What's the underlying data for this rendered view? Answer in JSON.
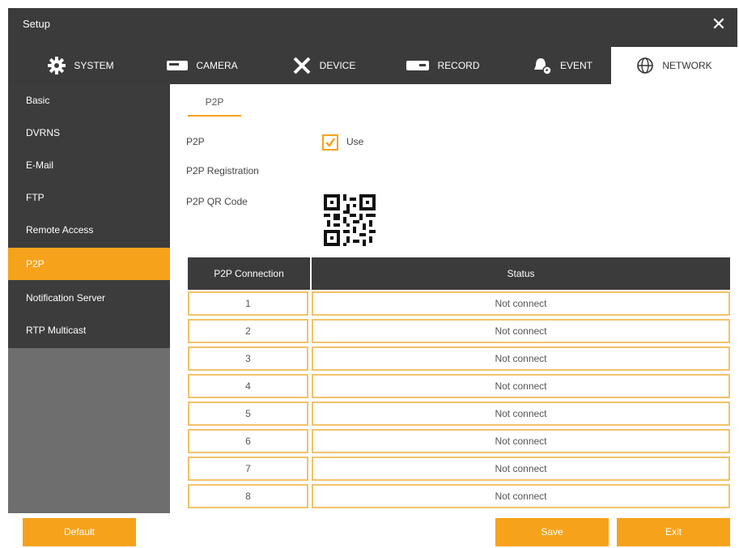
{
  "window": {
    "title": "Setup"
  },
  "tabs": [
    {
      "label": "SYSTEM",
      "icon": "gear-icon"
    },
    {
      "label": "CAMERA",
      "icon": "camera-icon"
    },
    {
      "label": "DEVICE",
      "icon": "tools-icon"
    },
    {
      "label": "RECORD",
      "icon": "recorder-icon"
    },
    {
      "label": "EVENT",
      "icon": "bell-icon"
    },
    {
      "label": "NETWORK",
      "icon": "globe-icon",
      "active": true
    }
  ],
  "sidebar": {
    "items": [
      {
        "label": "Basic"
      },
      {
        "label": "DVRNS"
      },
      {
        "label": "E-Mail"
      },
      {
        "label": "FTP"
      },
      {
        "label": "Remote Access"
      },
      {
        "label": "P2P",
        "active": true
      },
      {
        "label": "Notification Server"
      },
      {
        "label": "RTP Multicast"
      }
    ]
  },
  "main": {
    "subtab": "P2P",
    "p2p_label": "P2P",
    "use_label": "Use",
    "use_checked": true,
    "registration_label": "P2P Registration",
    "qr_label": "P2P QR Code",
    "table": {
      "headers": [
        "P2P Connection",
        "Status"
      ],
      "rows": [
        {
          "connection": "1",
          "status": "Not connect"
        },
        {
          "connection": "2",
          "status": "Not connect"
        },
        {
          "connection": "3",
          "status": "Not connect"
        },
        {
          "connection": "4",
          "status": "Not connect"
        },
        {
          "connection": "5",
          "status": "Not connect"
        },
        {
          "connection": "6",
          "status": "Not connect"
        },
        {
          "connection": "7",
          "status": "Not connect"
        },
        {
          "connection": "8",
          "status": "Not connect"
        }
      ]
    }
  },
  "footer": {
    "default_label": "Default",
    "save_label": "Save",
    "exit_label": "Exit"
  },
  "colors": {
    "accent": "#f7a21b",
    "header_bg": "#3b3b3b",
    "sidebar_bg": "#3c3c3c",
    "cell_border": "#f2c26a"
  }
}
